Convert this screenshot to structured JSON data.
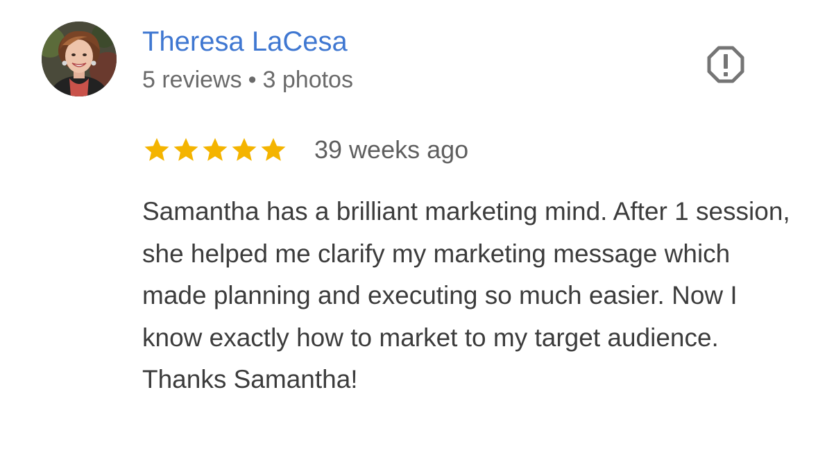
{
  "review": {
    "author": {
      "name": "Theresa LaCesa",
      "reviews_count": "5 reviews",
      "separator": "•",
      "photos_count": "3 photos",
      "avatar_icon": "profile-photo"
    },
    "rating": {
      "value": 5,
      "max": 5,
      "star_color": "#f4b400"
    },
    "time_ago": "39 weeks ago",
    "text": "Samantha has a brilliant marketing mind. After 1 session, she helped me clarify my marketing message which made planning and executing so much easier. Now I know exactly how to market to my target audience. Thanks Samantha!",
    "actions": {
      "report_icon": "report-octagon-icon"
    }
  },
  "colors": {
    "author_name": "#3f77d1",
    "secondary_text": "#6a6a6a",
    "body_text": "#3c3c3c",
    "icon": "#757575"
  }
}
